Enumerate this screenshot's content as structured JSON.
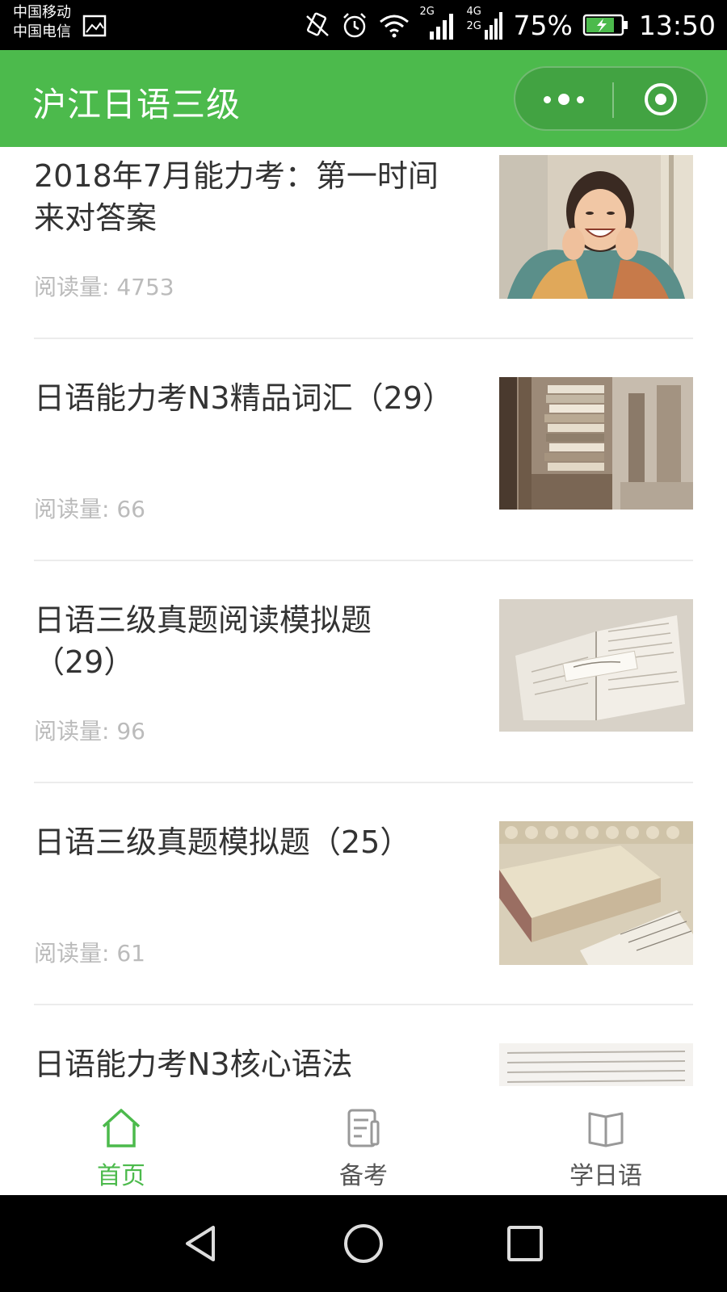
{
  "status_bar": {
    "carrier_1": "中国移动",
    "carrier_2": "中国电信",
    "network_1": "2G",
    "network_2": "4G",
    "network_3": "2G",
    "battery": "75%",
    "time": "13:50"
  },
  "header": {
    "title": "沪江日语三级",
    "more_icon": "more-dots-icon",
    "close_icon": "target-close-icon",
    "color": "#4cba4c"
  },
  "articles": [
    {
      "title": "2018年7月能力考：第一时间来对答案",
      "reads": "阅读量: 4753",
      "thumb": "smiling-woman-photo"
    },
    {
      "title": "日语能力考N3精品词汇（29）",
      "reads": "阅读量: 66",
      "thumb": "bookshelf-photo"
    },
    {
      "title": "日语三级真题阅读模拟题（29）",
      "reads": "阅读量: 96",
      "thumb": "open-book-photo"
    },
    {
      "title": "日语三级真题模拟题（25）",
      "reads": "阅读量: 61",
      "thumb": "book-on-lace-photo"
    },
    {
      "title": "日语能力考N3核心语法",
      "reads": "",
      "thumb": "text-page-photo"
    }
  ],
  "tabbar": {
    "tabs": [
      {
        "label": "首页",
        "icon": "home-icon",
        "active": true
      },
      {
        "label": "备考",
        "icon": "notes-pencil-icon",
        "active": false
      },
      {
        "label": "学日语",
        "icon": "open-book-icon",
        "active": false
      }
    ],
    "active_color": "#4cba4c"
  }
}
